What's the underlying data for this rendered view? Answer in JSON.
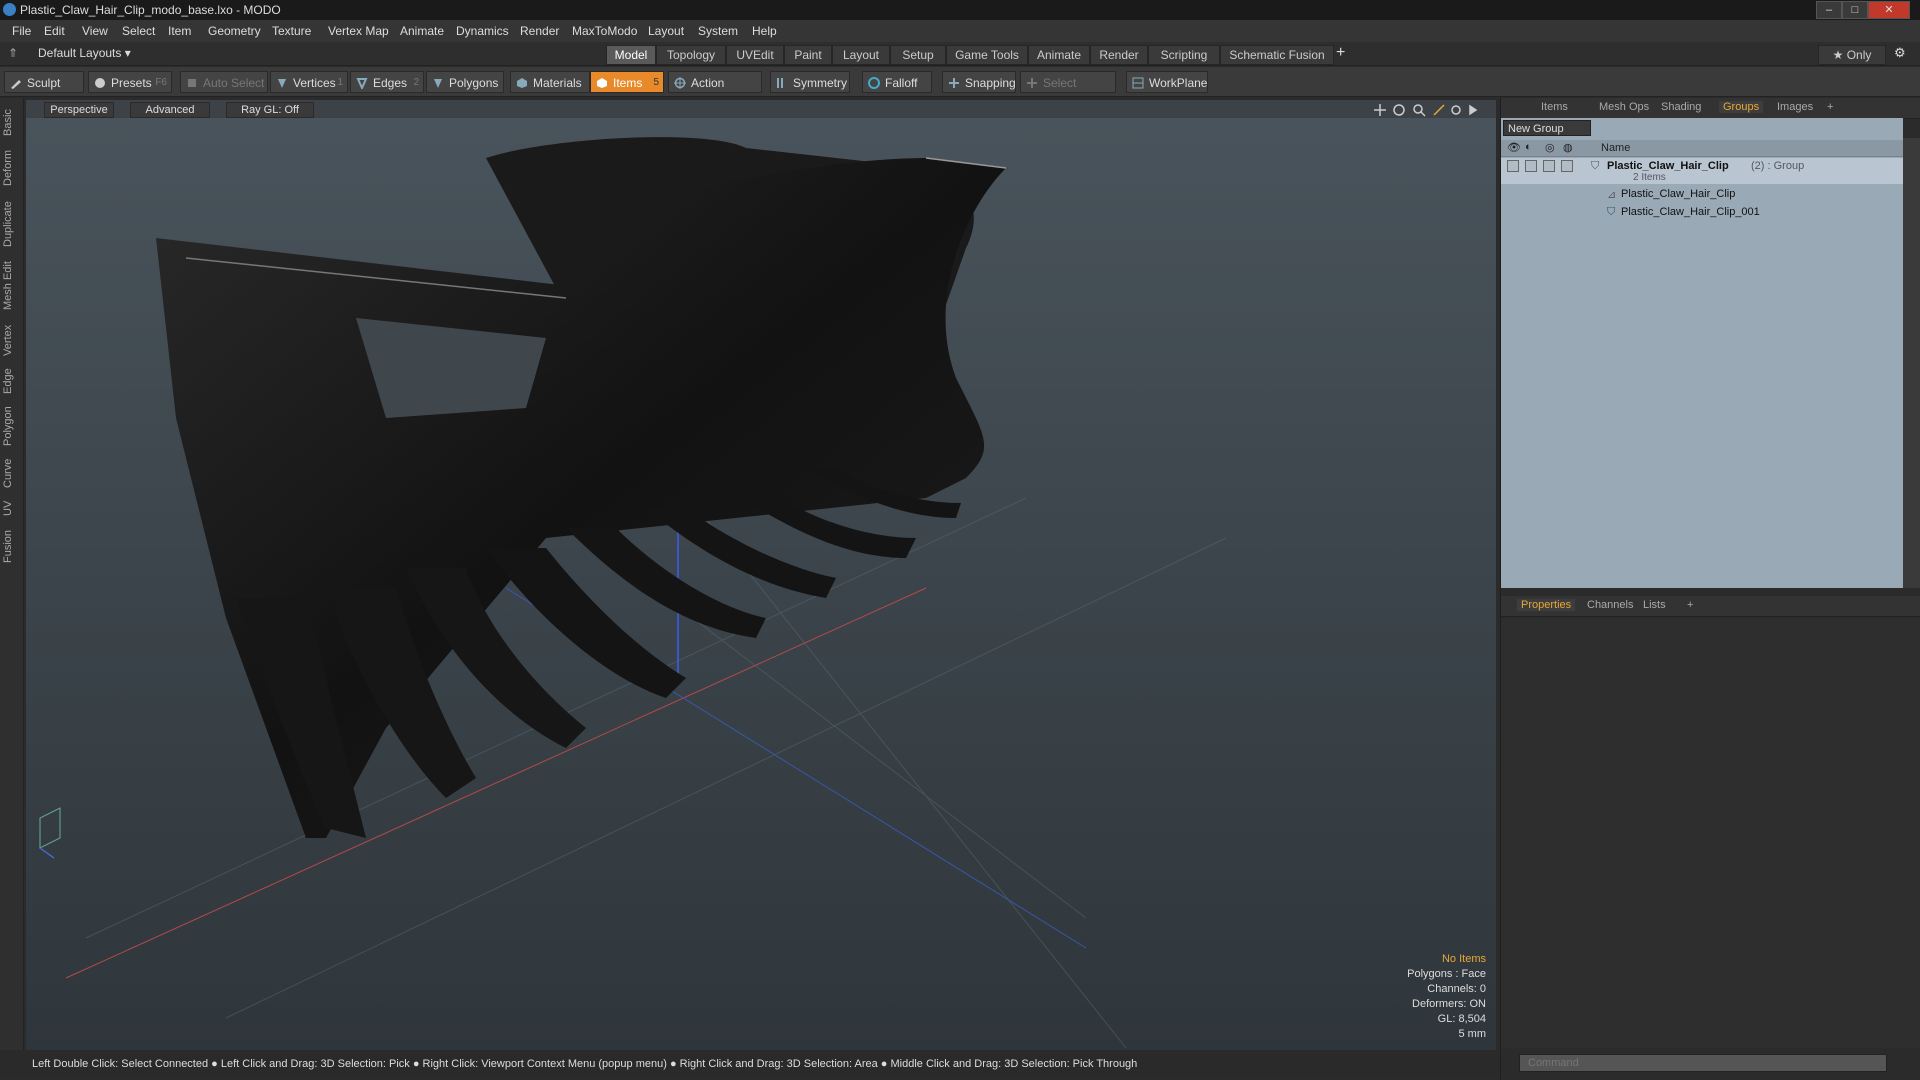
{
  "window": {
    "title": "Plastic_Claw_Hair_Clip_modo_base.lxo - MODO",
    "min": "–",
    "max": "□",
    "close": "✕"
  },
  "menu": [
    "File",
    "Edit",
    "View",
    "Select",
    "Item",
    "Geometry",
    "Texture",
    "Vertex Map",
    "Animate",
    "Dynamics",
    "Render",
    "MaxToModo",
    "Layout",
    "System",
    "Help"
  ],
  "layout": {
    "preset": "Default Layouts ▾",
    "tabs": [
      "Model",
      "Topology",
      "UVEdit",
      "Paint",
      "Layout",
      "Setup",
      "Game Tools",
      "Animate",
      "Render",
      "Scripting",
      "Schematic Fusion"
    ],
    "active_tab": "Model",
    "add": "+",
    "only": "★ Only",
    "gear": "⚙"
  },
  "toolbar": {
    "sculpt": "Sculpt",
    "presets": "Presets",
    "presets_key": "F6",
    "auto_select": "Auto Select",
    "vertices": "Vertices",
    "vertices_n": "1",
    "edges": "Edges",
    "edges_n": "2",
    "polygons": "Polygons",
    "materials": "Materials",
    "items": "Items",
    "items_n": "5",
    "action_center": "Action Center",
    "symmetry": "Symmetry",
    "falloff": "Falloff",
    "snapping": "Snapping",
    "select_through": "Select Through",
    "workplane": "WorkPlane"
  },
  "left_tabs": [
    "Basic",
    "Deform",
    "Duplicate",
    "Mesh Edit",
    "Vertex",
    "Edge",
    "Polygon",
    "Curve",
    "UV",
    "Fusion"
  ],
  "viewport": {
    "perspective": "Perspective",
    "advanced": "Advanced",
    "raygl": "Ray GL: Off",
    "info": {
      "no_items": "No Items",
      "polygons": "Polygons : Face",
      "channels": "Channels: 0",
      "deformers": "Deformers: ON",
      "gl": "GL: 8,504",
      "scale": "5 mm"
    }
  },
  "status": "Left Double Click: Select Connected ● Left Click and Drag: 3D Selection: Pick ● Right Click: Viewport Context Menu (popup menu) ● Right Click and Drag: 3D Selection: Area ● Middle Click and Drag: 3D Selection: Pick Through",
  "right": {
    "top_tabs": [
      "Items",
      "Mesh Ops",
      "Shading",
      "Groups",
      "Images"
    ],
    "active_top_tab": "Groups",
    "add": "+",
    "new_group": "New Group",
    "col_name": "Name",
    "group_name": "Plastic_Claw_Hair_Clip",
    "group_meta": "(2) : Group",
    "group_count": "2 Items",
    "children": [
      "Plastic_Claw_Hair_Clip",
      "Plastic_Claw_Hair_Clip_001"
    ],
    "bottom_tabs": [
      "Properties",
      "Channels",
      "Lists"
    ],
    "active_bottom_tab": "Properties",
    "command_placeholder": "Command"
  },
  "colors": {
    "accent": "#e8892a",
    "active_tab_text": "#e8a838"
  }
}
